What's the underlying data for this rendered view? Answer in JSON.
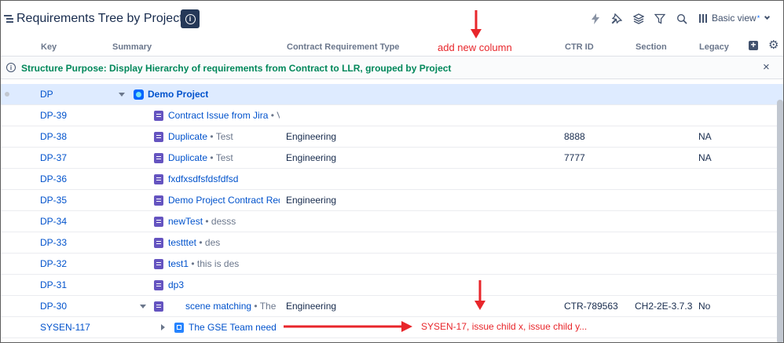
{
  "header": {
    "title": "Requirements Tree by Project",
    "view_label": "Basic view",
    "view_modified_mark": "*",
    "tool_icons": [
      "automation-icon",
      "pin-icon",
      "layers-icon",
      "filter-icon",
      "search-icon"
    ]
  },
  "columns": {
    "key": "Key",
    "summary": "Summary",
    "contract_requirement_type": "Contract Requirement Type",
    "ctr_id": "CTR ID",
    "section": "Section",
    "legacy": "Legacy"
  },
  "banner": {
    "text": "Structure Purpose: Display Hierarchy of requirements from Contract to LLR, grouped by Project",
    "close": "×"
  },
  "rows": [
    {
      "key": "DP",
      "title": "Demo Project",
      "desc": "",
      "type": "",
      "ctr": "",
      "section": "",
      "legacy": ""
    },
    {
      "key": "DP-39",
      "title": "Contract Issue from Jira",
      "desc": "• V",
      "type": "",
      "ctr": "",
      "section": "",
      "legacy": ""
    },
    {
      "key": "DP-38",
      "title": "Duplicate",
      "desc": "• Test",
      "type": "Engineering",
      "ctr": "8888",
      "section": "",
      "legacy": "NA"
    },
    {
      "key": "DP-37",
      "title": "Duplicate",
      "desc": "• Test",
      "type": "Engineering",
      "ctr": "7777",
      "section": "",
      "legacy": "NA"
    },
    {
      "key": "DP-36",
      "title": "fxdfxsdfsfdsfdfsd",
      "desc": "",
      "type": "",
      "ctr": "",
      "section": "",
      "legacy": ""
    },
    {
      "key": "DP-35",
      "title": "Demo Project Contract Req",
      "desc": "",
      "type": "Engineering",
      "ctr": "",
      "section": "",
      "legacy": ""
    },
    {
      "key": "DP-34",
      "title": "newTest",
      "desc": "• desss",
      "type": "",
      "ctr": "",
      "section": "",
      "legacy": ""
    },
    {
      "key": "DP-33",
      "title": "testttet",
      "desc": "• des",
      "type": "",
      "ctr": "",
      "section": "",
      "legacy": ""
    },
    {
      "key": "DP-32",
      "title": "test1",
      "desc": "• this is des",
      "type": "",
      "ctr": "",
      "section": "",
      "legacy": ""
    },
    {
      "key": "DP-31",
      "title": "dp3",
      "desc": "",
      "type": "",
      "ctr": "",
      "section": "",
      "legacy": ""
    },
    {
      "key": "DP-30",
      "title": "scene matching",
      "desc": "• The",
      "type": "Engineering",
      "ctr": "CTR-789563",
      "section": "CH2-2E-3.7.3",
      "legacy": "No"
    },
    {
      "key": "SYSEN-117",
      "title": "The GSE Team needs t",
      "desc": "",
      "type": "",
      "ctr": "",
      "section": "",
      "legacy": ""
    }
  ],
  "annotations": {
    "add_column": "add new column",
    "children": "SYSEN-17, issue child x, issue child y...",
    "color": "#e8262b"
  }
}
